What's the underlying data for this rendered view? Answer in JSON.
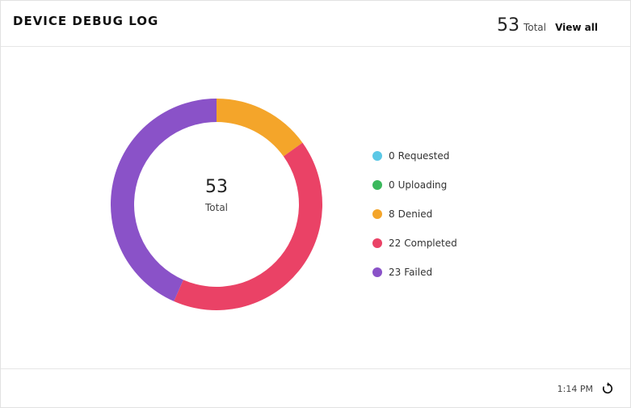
{
  "header": {
    "title": "DEVICE DEBUG LOG",
    "total_value": "53",
    "total_label": "Total",
    "view_all_label": "View all"
  },
  "center": {
    "value": "53",
    "label": "Total"
  },
  "legend": [
    {
      "count": "0",
      "label": "Requested",
      "color": "#5bc8e6"
    },
    {
      "count": "0",
      "label": "Uploading",
      "color": "#3bb85c"
    },
    {
      "count": "8",
      "label": "Denied",
      "color": "#f4a52a"
    },
    {
      "count": "22",
      "label": "Completed",
      "color": "#ea4266"
    },
    {
      "count": "23",
      "label": "Failed",
      "color": "#8a52c8"
    }
  ],
  "footer": {
    "timestamp": "1:14 PM",
    "refresh_icon": "refresh-icon"
  },
  "chart_data": {
    "type": "pie",
    "categories": [
      "Requested",
      "Uploading",
      "Denied",
      "Completed",
      "Failed"
    ],
    "values": [
      0,
      0,
      8,
      22,
      23
    ],
    "colors": [
      "#5bc8e6",
      "#3bb85c",
      "#f4a52a",
      "#ea4266",
      "#8a52c8"
    ],
    "donut": true,
    "center_value": "53",
    "center_label": "Total"
  }
}
